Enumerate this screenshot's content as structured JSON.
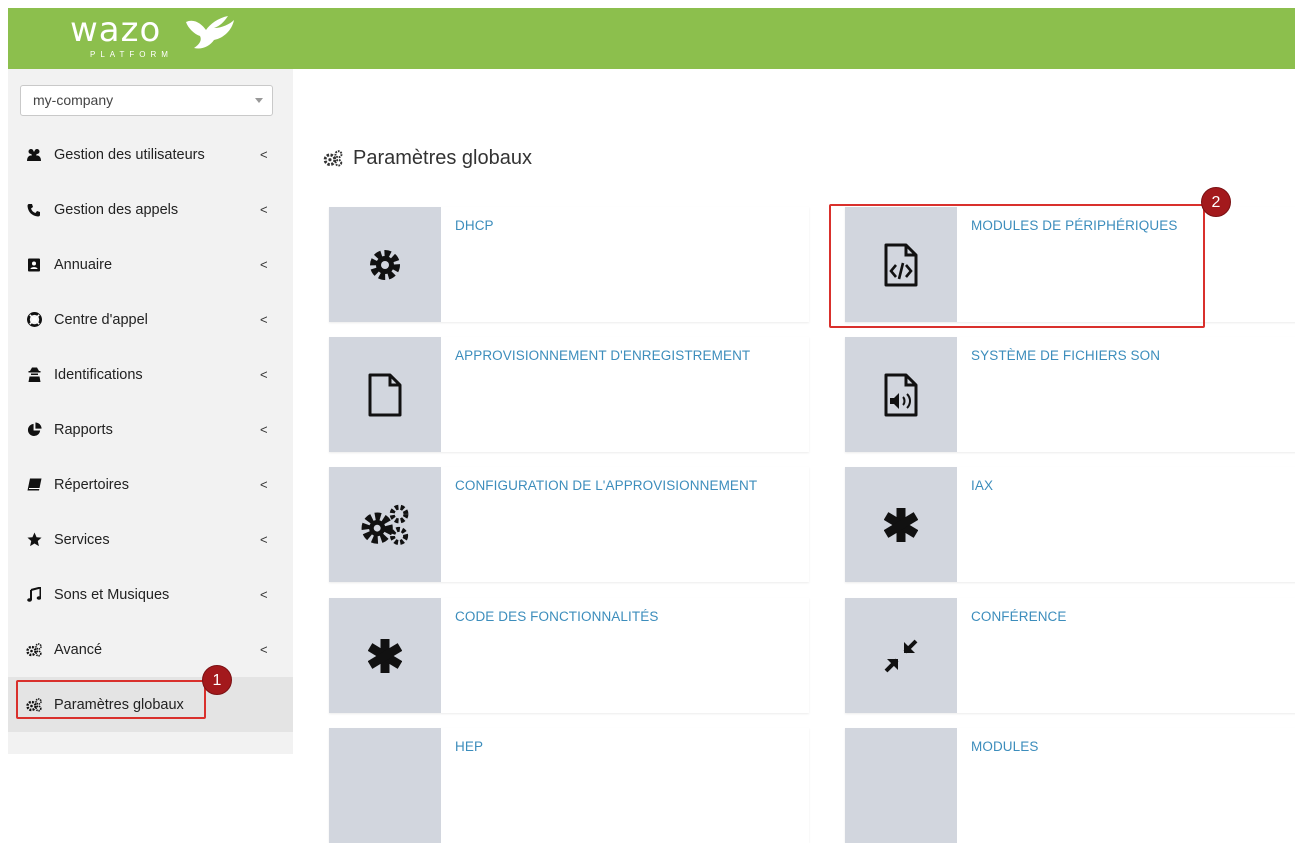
{
  "header": {
    "logo_text": "wazo",
    "logo_subtext": "PLATFORM",
    "bg_color": "#8cbf4d"
  },
  "tenant_select": {
    "value": "my-company"
  },
  "sidebar": {
    "items": [
      {
        "label": "Gestion des utilisateurs",
        "icon": "users-icon",
        "has_chevron": true
      },
      {
        "label": "Gestion des appels",
        "icon": "phone-icon",
        "has_chevron": true
      },
      {
        "label": "Annuaire",
        "icon": "address-book-icon",
        "has_chevron": true
      },
      {
        "label": "Centre d'appel",
        "icon": "life-ring-icon",
        "has_chevron": true
      },
      {
        "label": "Identifications",
        "icon": "user-secret-icon",
        "has_chevron": true
      },
      {
        "label": "Rapports",
        "icon": "pie-chart-icon",
        "has_chevron": true
      },
      {
        "label": "Répertoires",
        "icon": "book-icon",
        "has_chevron": true
      },
      {
        "label": "Services",
        "icon": "star-icon",
        "has_chevron": true
      },
      {
        "label": "Sons et Musiques",
        "icon": "music-icon",
        "has_chevron": true
      },
      {
        "label": "Avancé",
        "icon": "cogs-icon",
        "has_chevron": true
      },
      {
        "label": "Paramètres globaux",
        "icon": "cogs-icon",
        "has_chevron": false,
        "active": true
      }
    ],
    "chevron": "<"
  },
  "main": {
    "title": "Paramètres globaux",
    "cards": [
      {
        "label": "DHCP",
        "icon": "gear-icon"
      },
      {
        "label": "MODULES DE PÉRIPHÉRIQUES",
        "icon": "file-code-icon"
      },
      {
        "label": "APPROVISIONNEMENT D'ENREGISTREMENT",
        "icon": "file-icon"
      },
      {
        "label": "SYSTÈME DE FICHIERS SON",
        "icon": "file-audio-icon"
      },
      {
        "label": "CONFIGURATION DE L'APPROVISIONNEMENT",
        "icon": "cogs-icon"
      },
      {
        "label": "IAX",
        "icon": "asterisk-icon"
      },
      {
        "label": "CODE DES FONCTIONNALITÉS",
        "icon": "asterisk-icon"
      },
      {
        "label": "CONFÉRENCE",
        "icon": "compress-icon"
      },
      {
        "label": "HEP",
        "icon": ""
      },
      {
        "label": "MODULES",
        "icon": ""
      }
    ]
  },
  "annotations": {
    "badge_1": "1",
    "badge_2": "2",
    "color": "#d9302c"
  }
}
